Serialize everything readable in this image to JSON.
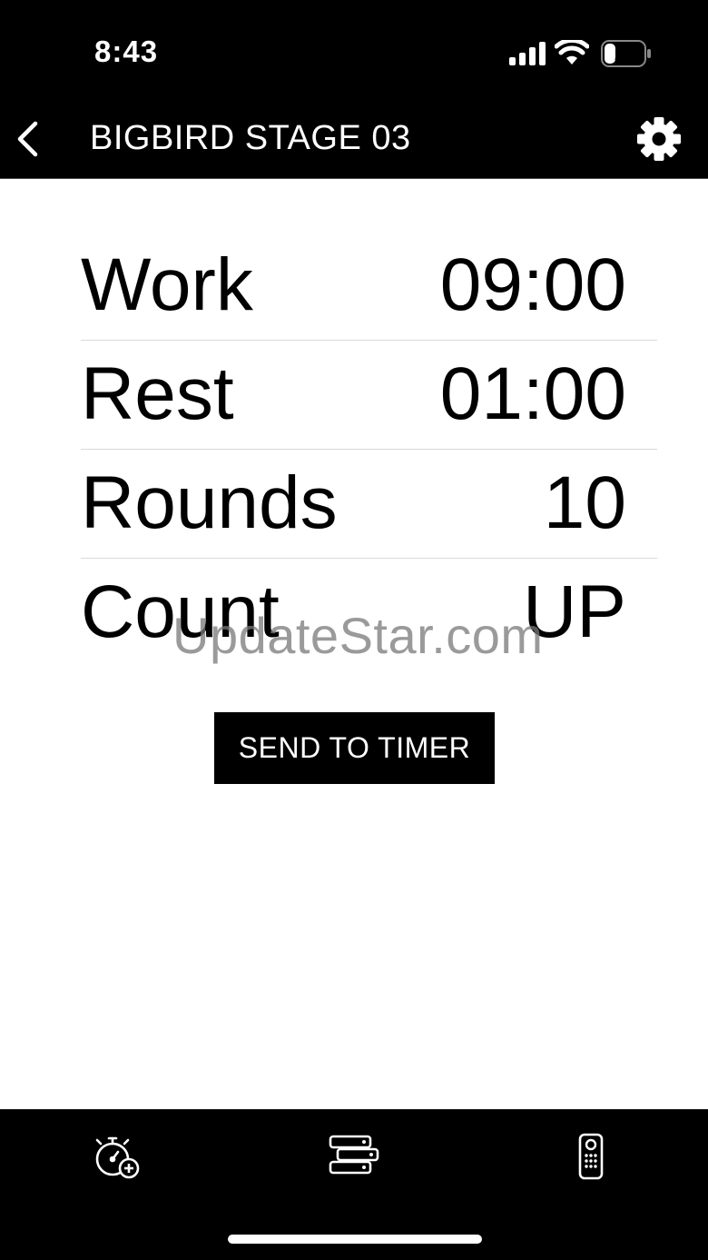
{
  "status_bar": {
    "time": "8:43",
    "battery_level": "21",
    "icons": [
      "cellular-signal-icon",
      "wifi-icon",
      "battery-icon"
    ]
  },
  "nav": {
    "title": "BIGBIRD STAGE 03",
    "back_icon": "chevron-left-icon",
    "settings_icon": "gear-icon"
  },
  "settings": [
    {
      "label": "Work",
      "value": "09:00"
    },
    {
      "label": "Rest",
      "value": "01:00"
    },
    {
      "label": "Rounds",
      "value": "10"
    },
    {
      "label": "Count",
      "value": "UP"
    }
  ],
  "watermark": "UpdateStar.com",
  "send_button_label": "SEND TO TIMER",
  "tab_bar": {
    "tabs": [
      {
        "icon": "stopwatch-add-icon"
      },
      {
        "icon": "server-stack-icon"
      },
      {
        "icon": "remote-control-icon"
      }
    ]
  },
  "colors": {
    "bar_background": "#000000",
    "content_background": "#ffffff",
    "divider": "#d9d9d9",
    "watermark": "#787878"
  }
}
